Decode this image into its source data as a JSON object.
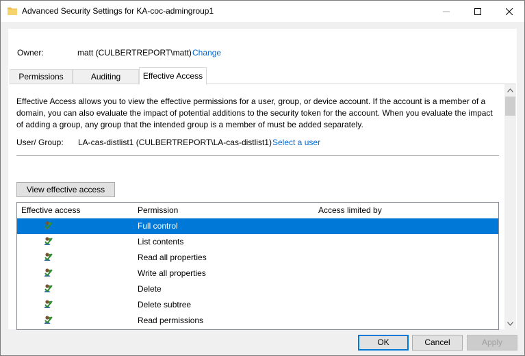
{
  "window": {
    "title": "Advanced Security Settings for KA-coc-admingroup1",
    "icon": "folder-icon"
  },
  "owner": {
    "label": "Owner:",
    "value": "matt (CULBERTREPORT\\matt)",
    "change_link": "Change"
  },
  "tabs": [
    {
      "label": "Permissions",
      "active": false
    },
    {
      "label": "Auditing",
      "active": false
    },
    {
      "label": "Effective Access",
      "active": true
    }
  ],
  "effective_access": {
    "description": "Effective Access allows you to view the effective permissions for a user, group, or device account. If the account is a member of a domain, you can also evaluate the impact of potential additions to the security token for the account. When you evaluate the impact of adding a group, any group that the intended group is a member of must be added separately.",
    "user_group_label": "User/ Group:",
    "user_group_value": "LA-cas-distlist1 (CULBERTREPORT\\LA-cas-distlist1)",
    "select_user_link": "Select a user",
    "view_button": "View effective access"
  },
  "grid": {
    "columns": [
      "Effective access",
      "Permission",
      "Access limited by"
    ],
    "rows": [
      {
        "permission": "Full control",
        "icon": "user-check-icon",
        "selected": true
      },
      {
        "permission": "List contents",
        "icon": "user-check-icon",
        "selected": false
      },
      {
        "permission": "Read all properties",
        "icon": "user-check-icon",
        "selected": false
      },
      {
        "permission": "Write all properties",
        "icon": "user-check-icon",
        "selected": false
      },
      {
        "permission": "Delete",
        "icon": "user-check-icon",
        "selected": false
      },
      {
        "permission": "Delete subtree",
        "icon": "user-check-icon",
        "selected": false
      },
      {
        "permission": "Read permissions",
        "icon": "user-check-icon",
        "selected": false
      }
    ]
  },
  "footer": {
    "ok": "OK",
    "cancel": "Cancel",
    "apply": "Apply"
  },
  "colors": {
    "accent": "#0078d7",
    "link": "#0066cc",
    "selection": "#0078d7"
  }
}
